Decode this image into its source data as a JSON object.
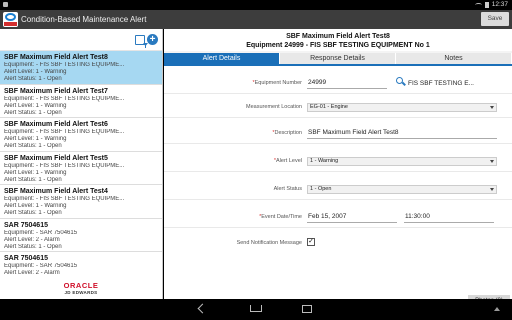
{
  "status_bar": {
    "time": "12:37"
  },
  "app": {
    "title": "Condition-Based Maintenance Alert",
    "save_label": "Save"
  },
  "alerts": [
    {
      "title": "SBF Maximum Field Alert Test8",
      "equipment": "Equipment: - FIS SBF TESTING EQUIPME...",
      "level": "Alert Level: 1 - Warning",
      "status": "Alert Status: 1 - Open",
      "selected": true
    },
    {
      "title": "SBF Maximum Field Alert Test7",
      "equipment": "Equipment: - FIS SBF TESTING EQUIPME...",
      "level": "Alert Level: 1 - Warning",
      "status": "Alert Status: 1 - Open"
    },
    {
      "title": "SBF Maximum Field Alert Test6",
      "equipment": "Equipment: - FIS SBF TESTING EQUIPME...",
      "level": "Alert Level: 1 - Warning",
      "status": "Alert Status: 1 - Open"
    },
    {
      "title": "SBF Maximum Field Alert Test5",
      "equipment": "Equipment: - FIS SBF TESTING EQUIPME...",
      "level": "Alert Level: 1 - Warning",
      "status": "Alert Status: 1 - Open"
    },
    {
      "title": "SBF Maximum Field Alert Test4",
      "equipment": "Equipment: - FIS SBF TESTING EQUIPME...",
      "level": "Alert Level: 1 - Warning",
      "status": "Alert Status: 1 - Open"
    },
    {
      "title": "SAR 7504615",
      "equipment": "Equipment: - SAR 7504615",
      "level": "Alert Level: 2 - Alarm",
      "status": "Alert Status: 1 - Open"
    },
    {
      "title": "SAR 7504615",
      "equipment": "Equipment: - SAR 7504615",
      "level": "Alert Level: 2 - Alarm",
      "status": "Alert Status: 1 - Open"
    }
  ],
  "footer_logo": {
    "brand": "ORACLE",
    "product": "JD EDWARDS"
  },
  "detail": {
    "heading": "SBF Maximum Field Alert Test8",
    "subheading": "Equipment 24999 - FIS SBF TESTING EQUIPMENT No 1",
    "tabs": [
      "Alert Details",
      "Response Details",
      "Notes"
    ],
    "active_tab": 0
  },
  "form": {
    "equipment_label": "Equipment Number",
    "equipment_value": "24999",
    "equipment_name": "FIS SBF TESTING E...",
    "location_label": "Measurement Location",
    "location_value": "EG-01 - Engine",
    "description_label": "Description",
    "description_value": "SBF Maximum Field Alert Test8",
    "level_label": "Alert Level",
    "level_value": "1 - Warning",
    "status_label": "Alert Status",
    "status_value": "1 - Open",
    "datetime_label": "Event Date/Time",
    "date_value": "Feb 15, 2007",
    "time_value": "11:30:00",
    "send_label": "Send Notification Message",
    "send_checked": true,
    "photos_label": "Photos (0)"
  },
  "colors": {
    "accent": "#1a6fb8",
    "selected_row": "#a6d8f2",
    "titlebar": "#3d3d3d",
    "oracle_red": "#d0102a"
  }
}
